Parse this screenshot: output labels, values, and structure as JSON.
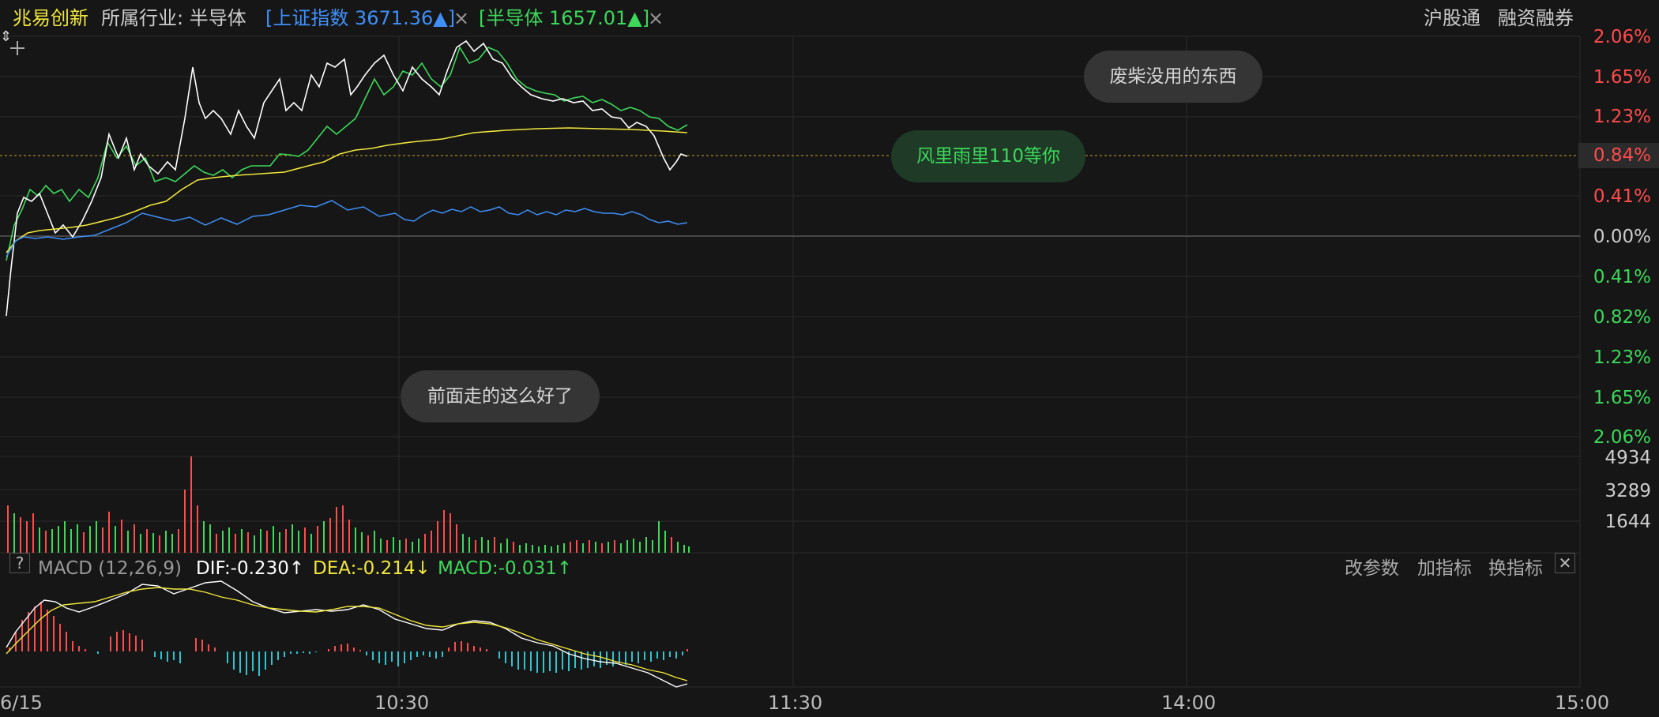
{
  "header": {
    "stock_name": "兆易创新",
    "industry_label": "所属行业: 半导体",
    "index1": "[上证指数 3671.36▲]",
    "index2": "[半导体 1657.01▲]",
    "close_glyph": "×",
    "right_links": [
      "沪股通",
      "融资融券"
    ]
  },
  "price_axis": {
    "up_labels": [
      "2.06%",
      "1.65%",
      "1.23%"
    ],
    "ref_label": "0.84%",
    "mid_labels": [
      "0.41%",
      "0.00%"
    ],
    "down_labels": [
      "0.41%",
      "0.82%",
      "1.23%",
      "1.65%",
      "2.06%"
    ]
  },
  "volume_axis": {
    "labels": [
      "4934",
      "3289",
      "1644"
    ]
  },
  "bubbles": {
    "top": "废柴没用的东西",
    "mid": "风里雨里110等你",
    "low": "前面走的这么好了"
  },
  "macd": {
    "help": "?",
    "title": "MACD (12,26,9)",
    "dif": "DIF:-0.230↑",
    "dea": "DEA:-0.214↓",
    "macd": "MACD:-0.031↑",
    "actions": [
      "改参数",
      "加指标",
      "换指标"
    ],
    "close_glyph": "✕"
  },
  "time_axis": {
    "labels": [
      "6/15",
      "10:30",
      "11:30",
      "14:00",
      "15:00"
    ]
  },
  "colors": {
    "up": "#ff4b4b",
    "down": "#3cd95a",
    "stock": "#ffffff",
    "avg": "#f0e63c",
    "sector": "#3cd95a",
    "index": "#3f8ff7",
    "hist_neg": "#2fc3d0",
    "grid": "#2a2a2a"
  }
}
